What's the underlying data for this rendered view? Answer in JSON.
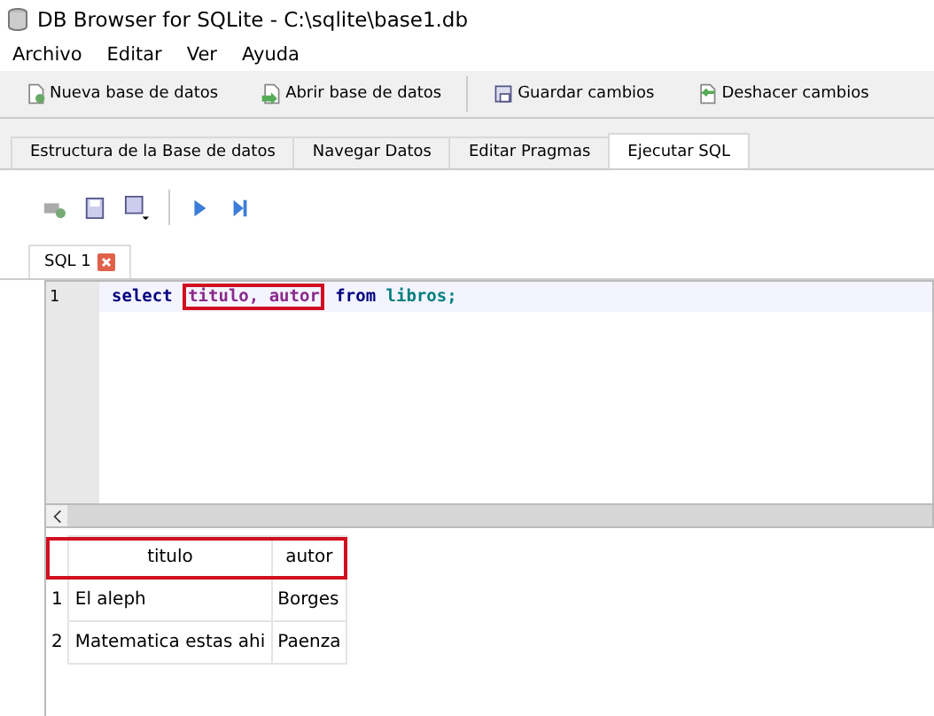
{
  "window": {
    "title": "DB Browser for SQLite - C:\\sqlite\\base1.db"
  },
  "menu": [
    "Archivo",
    "Editar",
    "Ver",
    "Ayuda"
  ],
  "toolbar": [
    {
      "label": "Nueva base de datos",
      "kind": "new"
    },
    {
      "label": "Abrir base de datos",
      "kind": "open"
    },
    {
      "label": "Guardar cambios",
      "kind": "save"
    },
    {
      "label": "Deshacer cambios",
      "kind": "undo"
    }
  ],
  "tabs": [
    {
      "label": "Estructura de la Base de datos",
      "selected": false
    },
    {
      "label": "Navegar Datos",
      "selected": false
    },
    {
      "label": "Editar Pragmas",
      "selected": false
    },
    {
      "label": "Ejecutar SQL",
      "selected": true
    }
  ],
  "sql_tabs": [
    {
      "label": "SQL 1",
      "selected": true
    }
  ],
  "editor": {
    "line_number": "1",
    "tokens": [
      {
        "text": "select",
        "kind": "keyword",
        "highlighted": false
      },
      {
        "text": "titulo, autor",
        "kind": "identifier",
        "highlighted": true
      },
      {
        "text": "from",
        "kind": "keyword",
        "highlighted": false
      },
      {
        "text": "libros;",
        "kind": "table",
        "highlighted": false
      }
    ]
  },
  "results": {
    "header_highlighted": true,
    "columns": [
      "titulo",
      "autor"
    ],
    "rows": [
      {
        "number": "1",
        "cells": [
          "El aleph",
          "Borges"
        ]
      },
      {
        "number": "2",
        "cells": [
          "Matematica estas ahi",
          "Paenza"
        ]
      }
    ]
  }
}
